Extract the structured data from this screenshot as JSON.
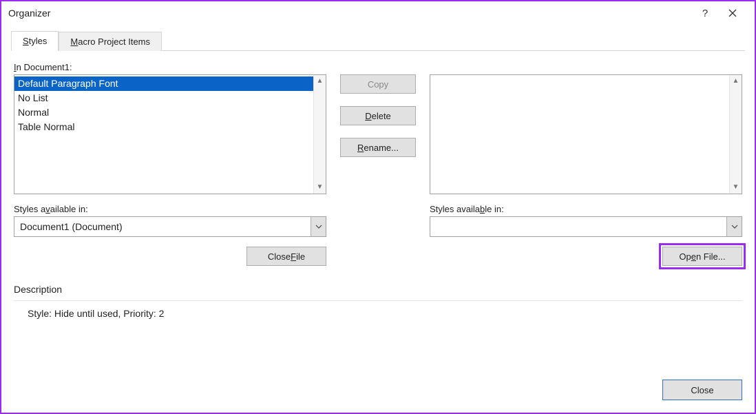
{
  "window": {
    "title": "Organizer",
    "help_hint": "?"
  },
  "tabs": {
    "styles": {
      "label_pre": "S",
      "label_rest": "tyles"
    },
    "macro": {
      "label_pre": "M",
      "label_rest": "acro Project Items"
    }
  },
  "left": {
    "in_label_pre": "I",
    "in_label_rest": "n Document1:",
    "items": [
      "Default Paragraph Font",
      "No List",
      "Normal",
      "Table Normal"
    ],
    "avail_label_pre": "Styles a",
    "avail_u": "v",
    "avail_label_post": "ailable in:",
    "select_value": "Document1 (Document)",
    "close_file_pre": "Close ",
    "close_file_u": "F",
    "close_file_post": "ile"
  },
  "right": {
    "avail_label_pre": "Styles availa",
    "avail_u": "b",
    "avail_label_post": "le in:",
    "select_value": "",
    "open_file_pre": "Op",
    "open_file_u": "e",
    "open_file_post": "n File..."
  },
  "buttons": {
    "copy": "Copy",
    "delete_pre": "",
    "delete_u": "D",
    "delete_post": "elete",
    "rename_pre": "",
    "rename_u": "R",
    "rename_post": "ename..."
  },
  "description": {
    "title": "Description",
    "body": "Style: Hide until used, Priority: 2"
  },
  "footer": {
    "close": "Close"
  }
}
